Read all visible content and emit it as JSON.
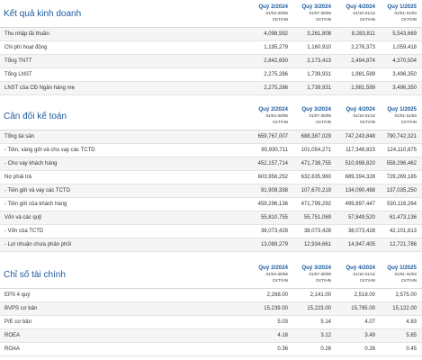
{
  "sections": [
    {
      "title": "Kết quả kinh doanh",
      "columns": [
        {
          "quarter": "Quý 2/2024",
          "range": "01/04-30/06",
          "unit": "CKT/HN"
        },
        {
          "quarter": "Quý 3/2024",
          "range": "01/07-30/09",
          "unit": "CKT/HN"
        },
        {
          "quarter": "Quý 4/2024",
          "range": "01/10-31/12",
          "unit": "CKT/HN"
        },
        {
          "quarter": "Quý 1/2025",
          "range": "01/01-31/03",
          "unit": "CKT/HN"
        }
      ],
      "rows": [
        {
          "label": "Thu nhập lãi thuần",
          "values": [
            "4,098,592",
            "3,261,808",
            "8,283,811",
            "5,543,669"
          ]
        },
        {
          "label": "Chi phí hoạt động",
          "values": [
            "1,195,279",
            "1,160,910",
            "2,276,373",
            "1,059,418"
          ]
        },
        {
          "label": "Tổng TNTT",
          "values": [
            "2,842,650",
            "2,173,413",
            "2,494,874",
            "4,370,504"
          ]
        },
        {
          "label": "Tổng LNST",
          "values": [
            "2,275,286",
            "1,739,931",
            "1,981,599",
            "3,496,350"
          ]
        },
        {
          "label": "LNST của CĐ Ngân hàng mẹ",
          "values": [
            "2,275,286",
            "1,739,931",
            "1,981,599",
            "3,496,350"
          ]
        }
      ]
    },
    {
      "title": "Cân đối kế toán",
      "columns": [
        {
          "quarter": "Quý 2/2024",
          "range": "01/04-30/06",
          "unit": "CKT/HN"
        },
        {
          "quarter": "Quý 3/2024",
          "range": "01/07-30/09",
          "unit": "CKT/HN"
        },
        {
          "quarter": "Quý 4/2024",
          "range": "01/10-31/12",
          "unit": "CKT/HN"
        },
        {
          "quarter": "Quý 1/2025",
          "range": "01/01-31/03",
          "unit": "CKT/HN"
        }
      ],
      "rows": [
        {
          "label": "Tổng tài sản",
          "values": [
            "659,767,007",
            "688,387,029",
            "747,243,848",
            "790,742,321"
          ]
        },
        {
          "label": "- Tiền, vàng gửi và cho vay các TCTD",
          "values": [
            "85,930,711",
            "101,054,271",
            "117,348,823",
            "124,110,875"
          ]
        },
        {
          "label": "- Cho vay khách hàng",
          "values": [
            "452,157,714",
            "471,738,755",
            "510,998,820",
            "558,296,462"
          ]
        },
        {
          "label": "Nợ phải trả",
          "values": [
            "603,956,252",
            "632,635,960",
            "689,394,328",
            "729,269,185"
          ]
        },
        {
          "label": "- Tiền gửi và vay các TCTD",
          "values": [
            "91,909,338",
            "107,670,219",
            "134,090,488",
            "137,035,250"
          ]
        },
        {
          "label": "- Tiền gửi của khách hàng",
          "values": [
            "459,296,136",
            "471,799,292",
            "499,897,447",
            "530,116,264"
          ]
        },
        {
          "label": "Vốn và các quỹ",
          "values": [
            "55,810,755",
            "55,751,069",
            "57,849,520",
            "61,473,136"
          ]
        },
        {
          "label": "- Vốn của TCTD",
          "values": [
            "38,073,428",
            "38,073,428",
            "38,073,428",
            "42,101,813"
          ]
        },
        {
          "label": "- Lợi nhuận chưa phân phối",
          "values": [
            "13,089,279",
            "12,934,661",
            "14,947,405",
            "12,721,786"
          ]
        }
      ]
    },
    {
      "title": "Chỉ số tài chính",
      "columns": [
        {
          "quarter": "Quý 2/2024",
          "range": "01/04-30/06",
          "unit": "CKT/HN"
        },
        {
          "quarter": "Quý 3/2024",
          "range": "01/07-30/09",
          "unit": "CKT/HN"
        },
        {
          "quarter": "Quý 4/2024",
          "range": "01/10-31/12",
          "unit": "CKT/HN"
        },
        {
          "quarter": "Quý 1/2025",
          "range": "01/01-31/03",
          "unit": "CKT/HN"
        }
      ],
      "rows": [
        {
          "label": "EPS 4 quý",
          "values": [
            "2,268.00",
            "2,141.00",
            "2,518.00",
            "2,575.00"
          ]
        },
        {
          "label": "BVPS cơ bản",
          "values": [
            "15,239.00",
            "15,223.00",
            "15,795.00",
            "15,122.00"
          ]
        },
        {
          "label": "P/E cơ bản",
          "values": [
            "5.03",
            "5.14",
            "4.07",
            "4.83"
          ]
        },
        {
          "label": "ROEA",
          "values": [
            "4.18",
            "3.12",
            "3.49",
            "5.85"
          ]
        },
        {
          "label": "ROAA",
          "values": [
            "0.36",
            "0.26",
            "0.28",
            "0.45"
          ]
        }
      ]
    }
  ]
}
